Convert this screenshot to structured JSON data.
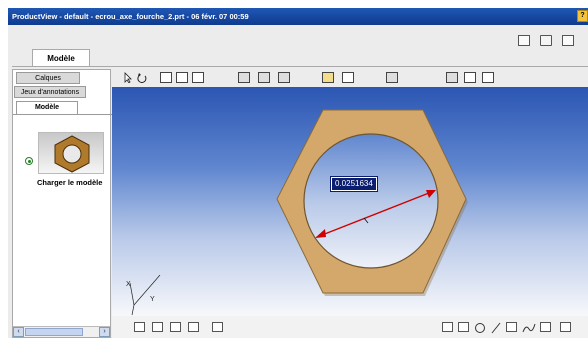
{
  "window": {
    "title": "ProductView - default - ecrou_axe_fourche_2.prt - 06 févr. 07 00:59",
    "help_label": "?"
  },
  "main_tab": {
    "label": "Modèle"
  },
  "left_panel": {
    "tabs": [
      {
        "label": "Calques"
      },
      {
        "label": "Jeux d'annotations"
      },
      {
        "label": "Modèle"
      }
    ],
    "load_model_label": "Charger le modèle"
  },
  "viewport": {
    "dimension_value": "0.0251634",
    "axis_labels": {
      "x": "X",
      "y": "Y",
      "z": "Z"
    },
    "colors": {
      "part_face": "#d4a86a",
      "part_edge": "#8a6a3a",
      "dimension_arrow": "#d00000",
      "background_top": "#2b56b3",
      "background_bottom": "#f7f8fb"
    }
  },
  "icons": {
    "top_right": [
      "export-icon",
      "print-icon",
      "window-icon"
    ],
    "toolbar": [
      "select-pointer-icon",
      "rotate-icon",
      "zoom-window-icon",
      "zoom-fit-icon",
      "zoom-icon",
      "front-view-icon",
      "side-view-icon",
      "top-view-icon",
      "lighting-icon",
      "render-mode-icon",
      "settings-icon",
      "shaded-view-icon",
      "wireframe-icon",
      "hidden-line-icon"
    ],
    "bottom": [
      "markup-icon",
      "measure-icon",
      "annotation-icon",
      "comment-icon",
      "properties-icon",
      "notes-icon",
      "rectangle-icon",
      "circle-icon",
      "line-icon",
      "edit-icon",
      "freehand-icon",
      "text-box-icon",
      "dimension-icon"
    ]
  }
}
